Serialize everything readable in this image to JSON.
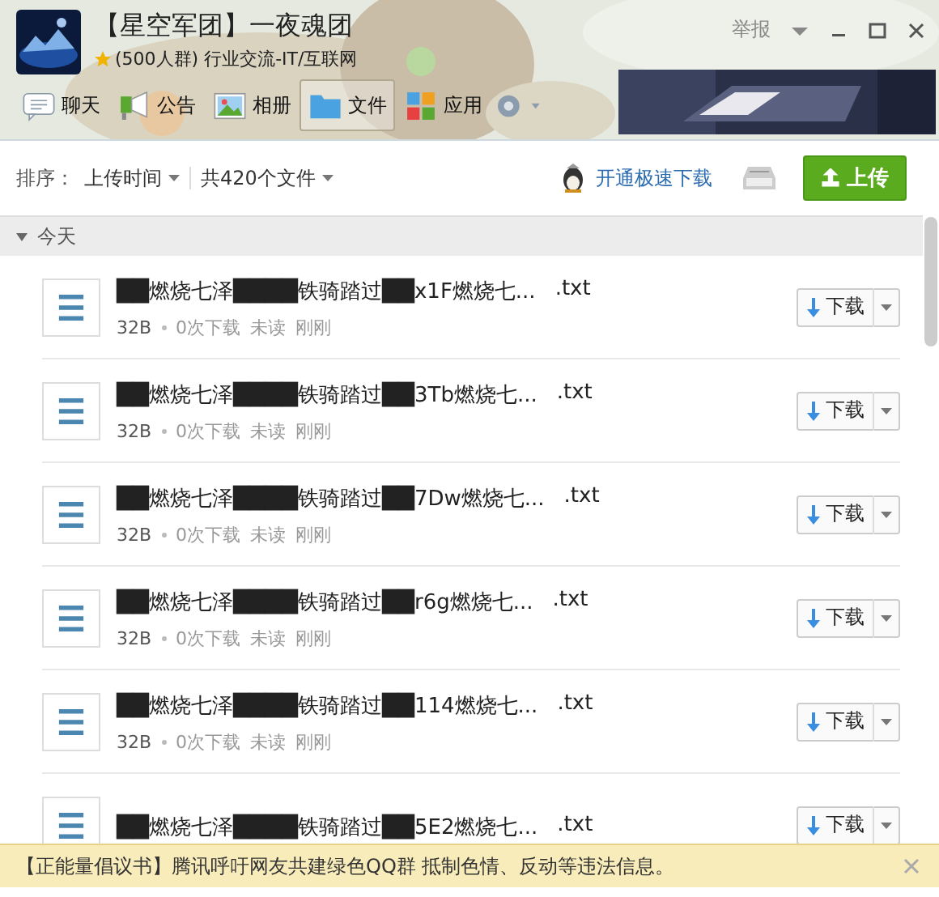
{
  "window": {
    "title": "【星空军团】一夜魂团",
    "subtitle": "(500人群) 行业交流-IT/互联网",
    "report": "举报"
  },
  "tabs": [
    {
      "label": "聊天",
      "kind": "chat",
      "selected": false
    },
    {
      "label": "公告",
      "kind": "notice",
      "selected": false
    },
    {
      "label": "相册",
      "kind": "album",
      "selected": false
    },
    {
      "label": "文件",
      "kind": "folder",
      "selected": true
    },
    {
      "label": "应用",
      "kind": "apps",
      "selected": false
    }
  ],
  "toolbar": {
    "sort_label": "排序：",
    "sort_value": "上传时间",
    "count": "共420个文件",
    "vip_link": "开通极速下载",
    "upload_button": "上传"
  },
  "group": {
    "label": "今天",
    "expanded": true
  },
  "files": [
    {
      "name": "██燃烧七泽████铁骑踏过██x1F燃烧七...",
      "ext": ".txt",
      "size": "32B",
      "downloads": "0次下载",
      "status": "未读",
      "time": "刚刚",
      "action": "下载"
    },
    {
      "name": "██燃烧七泽████铁骑踏过██3Tb燃烧七...",
      "ext": ".txt",
      "size": "32B",
      "downloads": "0次下载",
      "status": "未读",
      "time": "刚刚",
      "action": "下载"
    },
    {
      "name": "██燃烧七泽████铁骑踏过██7Dw燃烧七...",
      "ext": ".txt",
      "size": "32B",
      "downloads": "0次下载",
      "status": "未读",
      "time": "刚刚",
      "action": "下载"
    },
    {
      "name": "██燃烧七泽████铁骑踏过██r6g燃烧七...",
      "ext": ".txt",
      "size": "32B",
      "downloads": "0次下载",
      "status": "未读",
      "time": "刚刚",
      "action": "下载"
    },
    {
      "name": "██燃烧七泽████铁骑踏过██114燃烧七...",
      "ext": ".txt",
      "size": "32B",
      "downloads": "0次下载",
      "status": "未读",
      "time": "刚刚",
      "action": "下载"
    },
    {
      "name": "██燃烧七泽████铁骑踏过██5E2燃烧七...",
      "ext": ".txt",
      "action": "下载"
    }
  ],
  "notice": {
    "text": "【正能量倡议书】腾讯呼吁网友共建绿色QQ群 抵制色情、反动等违法信息。"
  }
}
